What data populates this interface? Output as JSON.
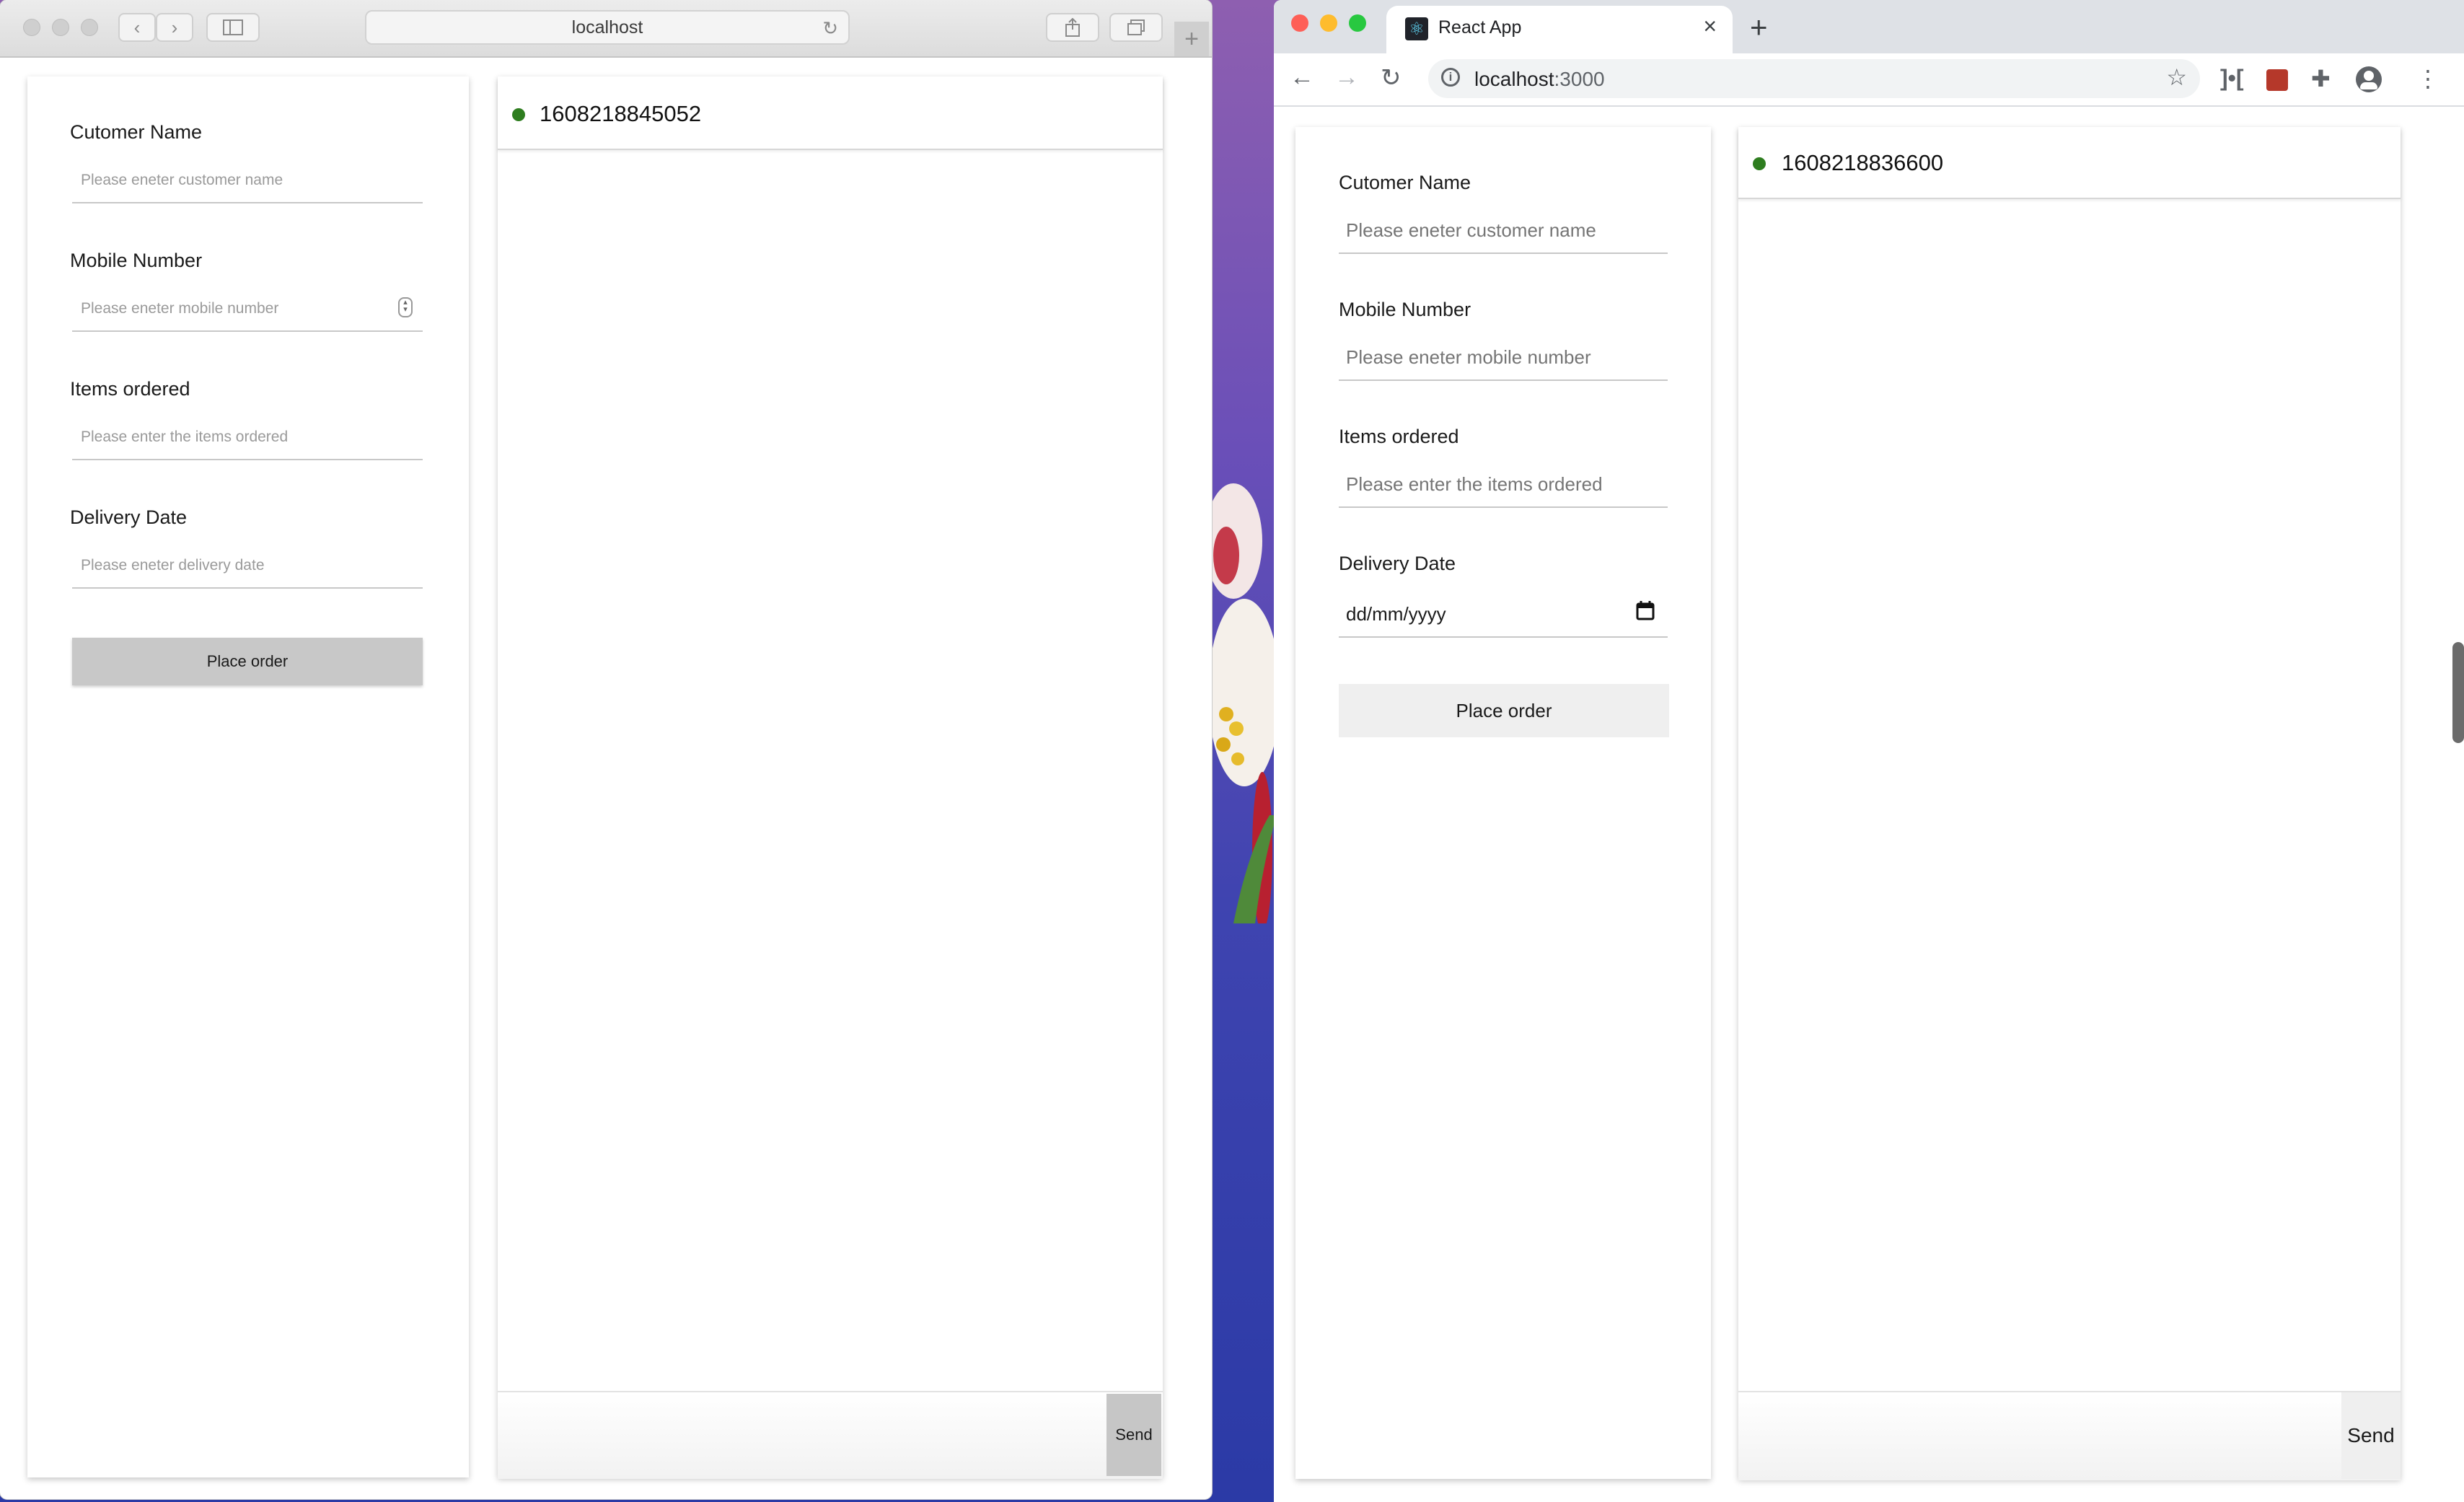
{
  "safari": {
    "address": "localhost",
    "form": {
      "customer_name_label": "Cutomer Name",
      "customer_name_placeholder": "Please eneter customer name",
      "mobile_label": "Mobile Number",
      "mobile_placeholder": "Please eneter mobile number",
      "items_label": "Items ordered",
      "items_placeholder": "Please enter the items ordered",
      "date_label": "Delivery Date",
      "date_placeholder": "Please eneter delivery date",
      "submit_label": "Place order"
    },
    "chat": {
      "id": "1608218845052",
      "send_label": "Send",
      "status_color": "#2e7d1f"
    }
  },
  "chrome": {
    "tab_title": "React App",
    "url_host": "localhost",
    "url_port": ":3000",
    "form": {
      "customer_name_label": "Cutomer Name",
      "customer_name_placeholder": "Please eneter customer name",
      "mobile_label": "Mobile Number",
      "mobile_placeholder": "Please eneter mobile number",
      "items_label": "Items ordered",
      "items_placeholder": "Please enter the items ordered",
      "date_label": "Delivery Date",
      "date_value": "dd/mm/yyyy",
      "submit_label": "Place order"
    },
    "chat": {
      "id": "1608218836600",
      "send_label": "Send",
      "status_color": "#2e7d1f"
    }
  },
  "icons": [
    "back-icon",
    "forward-icon",
    "sidebar-icon",
    "reload-icon",
    "share-icon",
    "tabs-icon",
    "plus-icon",
    "react-favicon",
    "close-icon",
    "info-icon",
    "star-icon",
    "extension-icon",
    "profile-icon",
    "menu-icon",
    "calendar-icon",
    "spinner-icon"
  ]
}
